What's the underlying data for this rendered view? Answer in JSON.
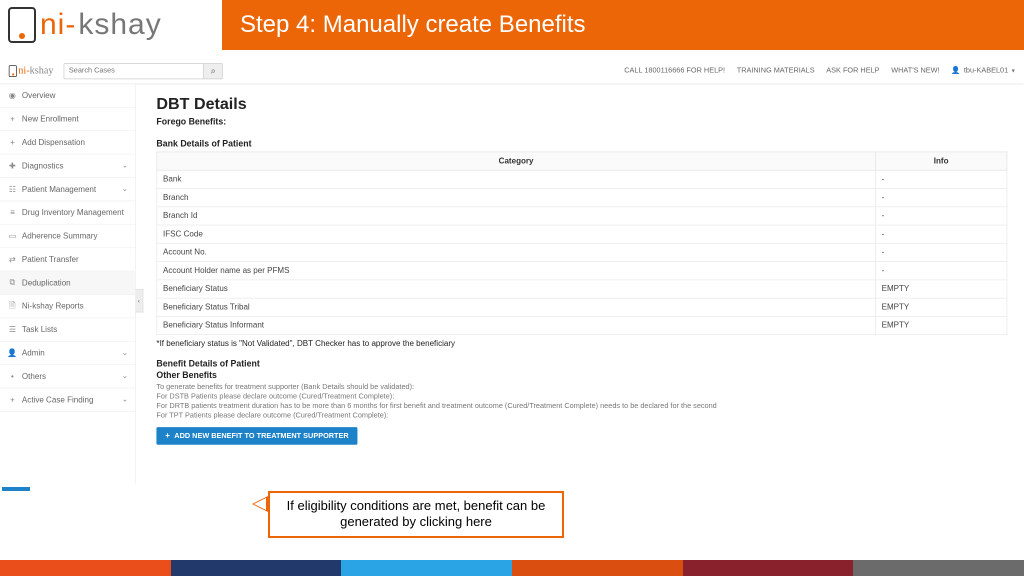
{
  "slide": {
    "title": "Step 4: Manually create Benefits"
  },
  "logo": {
    "part1": "ni-",
    "part2": "kshay"
  },
  "search": {
    "placeholder": "Search Cases"
  },
  "toplinks": {
    "help_call": "CALL 1800116666 FOR HELP!",
    "training": "TRAINING MATERIALS",
    "ask": "ASK FOR HELP",
    "whatsnew": "WHAT'S NEW!",
    "user": "tbu-KABEL01"
  },
  "sidebar": {
    "items": [
      {
        "icon": "◉",
        "label": "Overview",
        "expandable": false
      },
      {
        "icon": "+",
        "label": "New Enrollment",
        "expandable": false
      },
      {
        "icon": "+",
        "label": "Add Dispensation",
        "expandable": false
      },
      {
        "icon": "✚",
        "label": "Diagnostics",
        "expandable": true
      },
      {
        "icon": "☷",
        "label": "Patient Management",
        "expandable": true
      },
      {
        "icon": "≡",
        "label": "Drug Inventory Management",
        "expandable": false
      },
      {
        "icon": "▭",
        "label": "Adherence Summary",
        "expandable": false
      },
      {
        "icon": "⇄",
        "label": "Patient Transfer",
        "expandable": false
      },
      {
        "icon": "⧉",
        "label": "Deduplication",
        "expandable": false,
        "selected": true
      },
      {
        "icon": "🗎",
        "label": "Ni-kshay Reports",
        "expandable": false
      },
      {
        "icon": "☰",
        "label": "Task Lists",
        "expandable": false
      },
      {
        "icon": "👤",
        "label": "Admin",
        "expandable": true
      },
      {
        "icon": "•",
        "label": "Others",
        "expandable": true
      },
      {
        "icon": "+",
        "label": "Active Case Finding",
        "expandable": true
      }
    ]
  },
  "main": {
    "title": "DBT Details",
    "forego": "Forego Benefits:",
    "bank_header": "Bank Details of Patient",
    "table_headers": {
      "category": "Category",
      "info": "Info"
    },
    "bank_rows": [
      {
        "category": "Bank",
        "info": "-"
      },
      {
        "category": "Branch",
        "info": "-"
      },
      {
        "category": "Branch Id",
        "info": "-"
      },
      {
        "category": "IFSC Code",
        "info": "-"
      },
      {
        "category": "Account No.",
        "info": "-"
      },
      {
        "category": "Account Holder name as per PFMS",
        "info": "-"
      },
      {
        "category": "Beneficiary Status",
        "info": "EMPTY"
      },
      {
        "category": "Beneficiary Status Tribal",
        "info": "EMPTY"
      },
      {
        "category": "Beneficiary Status Informant",
        "info": "EMPTY"
      }
    ],
    "note": "*If beneficiary status is \"Not Validated\", DBT Checker has to approve the beneficiary",
    "benefit_header": "Benefit Details of Patient",
    "other_benefits": "Other Benefits",
    "lines": [
      "To generate benefits for treatment supporter (Bank Details should be validated):",
      "For DSTB Patients please declare outcome (Cured/Treatment Complete):",
      "For DRTB patients treatment duration has to be more than 6 months for first benefit and treatment outcome (Cured/Treatment Complete) needs to be declared for the second",
      "For TPT Patients please declare outcome (Cured/Treatment Complete):"
    ],
    "add_button": "Add New Benefit to Treatment Supporter"
  },
  "callout": "If eligibility conditions are met, benefit can be generated by clicking here",
  "footer_colors": [
    "#e94e1b",
    "#223a6b",
    "#2aa4e5",
    "#da4f10",
    "#88212b",
    "#6b6b6b"
  ]
}
